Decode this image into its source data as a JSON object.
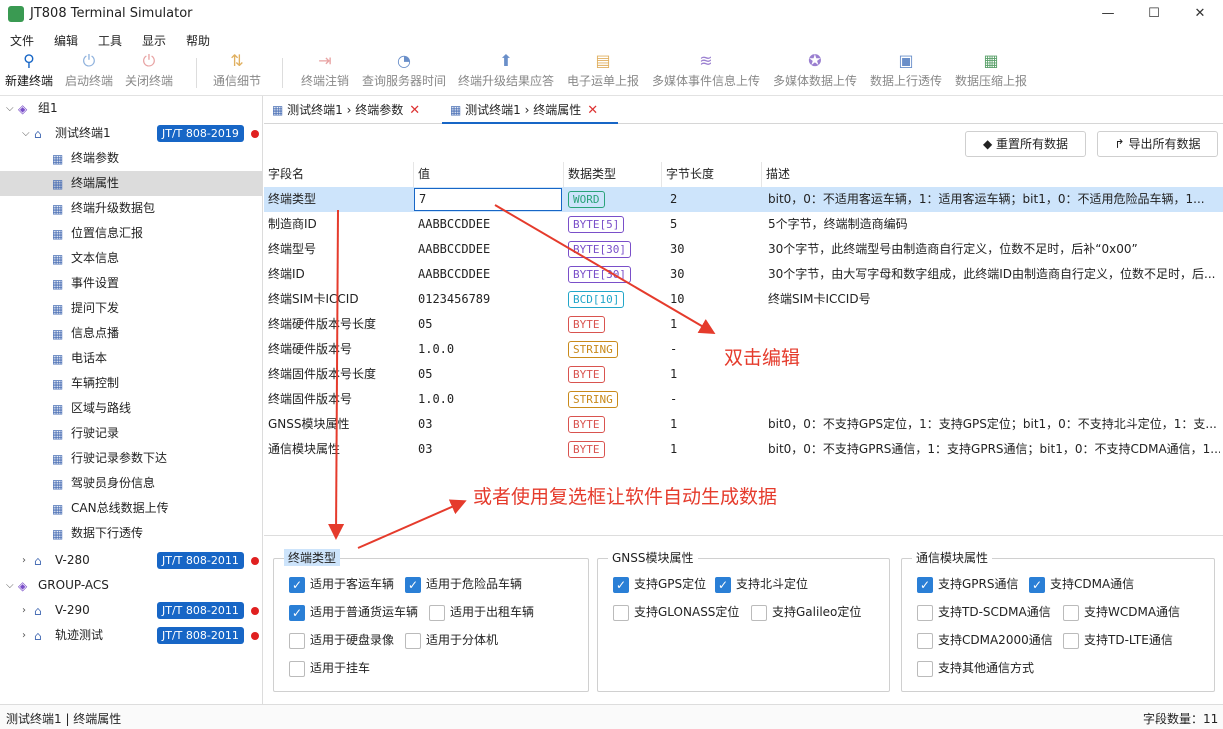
{
  "window": {
    "title": "JT808 Terminal Simulator",
    "min": "—",
    "max": "☐",
    "close": "✕"
  },
  "menu": [
    "文件",
    "编辑",
    "工具",
    "显示",
    "帮助"
  ],
  "toolbar": [
    {
      "label": "新建终端",
      "icon": "new-terminal-icon",
      "enabled": true
    },
    {
      "label": "启动终端",
      "icon": "power-icon",
      "enabled": false
    },
    {
      "label": "关闭终端",
      "icon": "power-off-icon",
      "enabled": false
    },
    {
      "label": "通信细节",
      "icon": "traffic-icon",
      "enabled": false
    },
    {
      "label": "终端注销",
      "icon": "logout-icon",
      "enabled": false
    },
    {
      "label": "查询服务器时间",
      "icon": "clock-icon",
      "enabled": false
    },
    {
      "label": "终端升级结果应答",
      "icon": "upload-icon",
      "enabled": false
    },
    {
      "label": "电子运单上报",
      "icon": "clipboard-icon",
      "enabled": false
    },
    {
      "label": "多媒体事件信息上传",
      "icon": "audio-wave-icon",
      "enabled": false
    },
    {
      "label": "多媒体数据上传",
      "icon": "film-reel-icon",
      "enabled": false
    },
    {
      "label": "数据上行透传",
      "icon": "data-up-icon",
      "enabled": false
    },
    {
      "label": "数据压缩上报",
      "icon": "package-icon",
      "enabled": false
    }
  ],
  "tree": {
    "group1": "组1",
    "terminal1": {
      "label": "测试终端1",
      "badge": "JT/T 808-2019"
    },
    "children": [
      "终端参数",
      "终端属性",
      "终端升级数据包",
      "位置信息汇报",
      "文本信息",
      "事件设置",
      "提问下发",
      "信息点播",
      "电话本",
      "车辆控制",
      "区域与路线",
      "行驶记录",
      "行驶记录参数下达",
      "驾驶员身份信息",
      "CAN总线数据上传",
      "数据下行透传"
    ],
    "selected_index": 1,
    "v280": {
      "label": "V-280",
      "badge": "JT/T 808-2011"
    },
    "group_acs": "GROUP-ACS",
    "v290": {
      "label": "V-290",
      "badge": "JT/T 808-2011"
    },
    "track": {
      "label": "轨迹测试",
      "badge": "JT/T 808-2011"
    }
  },
  "tabs": [
    {
      "label": "测试终端1 › 终端参数",
      "close": "✕"
    },
    {
      "label": "测试终端1 › 终端属性",
      "close": "✕"
    }
  ],
  "actions": {
    "reset": "重置所有数据",
    "export": "导出所有数据"
  },
  "grid": {
    "headers": [
      "字段名",
      "值",
      "数据类型",
      "字节长度",
      "描述"
    ],
    "rows": [
      {
        "name": "终端类型",
        "value": "7",
        "type": "WORD",
        "len": "2",
        "desc": "bit0，0：不适用客运车辆，1：适用客运车辆；bit1，0：不适用危险品车辆，1..."
      },
      {
        "name": "制造商ID",
        "value": "AABBCCDDEE",
        "type": "BYTE[5]",
        "len": "5",
        "desc": "5个字节，终端制造商编码"
      },
      {
        "name": "终端型号",
        "value": "AABBCCDDEE",
        "type": "BYTE[30]",
        "len": "30",
        "desc": "30个字节，此终端型号由制造商自行定义，位数不足时，后补“0x00”"
      },
      {
        "name": "终端ID",
        "value": "AABBCCDDEE",
        "type": "BYTE[30]",
        "len": "30",
        "desc": "30个字节，由大写字母和数字组成，此终端ID由制造商自行定义，位数不足时，后..."
      },
      {
        "name": "终端SIM卡ICCID",
        "value": "0123456789",
        "type": "BCD[10]",
        "len": "10",
        "desc": "终端SIM卡ICCID号"
      },
      {
        "name": "终端硬件版本号长度",
        "value": "05",
        "type": "BYTE",
        "len": "1",
        "desc": ""
      },
      {
        "name": "终端硬件版本号",
        "value": "1.0.0",
        "type": "STRING",
        "len": "-",
        "desc": ""
      },
      {
        "name": "终端固件版本号长度",
        "value": "05",
        "type": "BYTE",
        "len": "1",
        "desc": ""
      },
      {
        "name": "终端固件版本号",
        "value": "1.0.0",
        "type": "STRING",
        "len": "-",
        "desc": ""
      },
      {
        "name": "GNSS模块属性",
        "value": "03",
        "type": "BYTE",
        "len": "1",
        "desc": "bit0，0：不支持GPS定位，1：支持GPS定位；bit1，0：不支持北斗定位，1：支..."
      },
      {
        "name": "通信模块属性",
        "value": "03",
        "type": "BYTE",
        "len": "1",
        "desc": "bit0，0：不支持GPRS通信，1：支持GPRS通信；bit1，0：不支持CDMA通信，1..."
      }
    ]
  },
  "type_colors": {
    "WORD": "#2aa37a",
    "BYTE[5]": "#7a4fc9",
    "BYTE[30]": "#7a4fc9",
    "BCD[10]": "#22a6c9",
    "BYTE": "#d9534f",
    "STRING": "#c98a1a"
  },
  "groups": {
    "terminal_type": {
      "title": "终端类型",
      "items": [
        {
          "label": "适用于客运车辆",
          "checked": true
        },
        {
          "label": "适用于危险品车辆",
          "checked": true
        },
        {
          "label": "适用于普通货运车辆",
          "checked": true
        },
        {
          "label": "适用于出租车辆",
          "checked": false
        },
        {
          "label": "适用于硬盘录像",
          "checked": false
        },
        {
          "label": "适用于分体机",
          "checked": false
        },
        {
          "label": "适用于挂车",
          "checked": false
        }
      ]
    },
    "gnss": {
      "title": "GNSS模块属性",
      "items": [
        {
          "label": "支持GPS定位",
          "checked": true
        },
        {
          "label": "支持北斗定位",
          "checked": true
        },
        {
          "label": "支持GLONASS定位",
          "checked": false
        },
        {
          "label": "支持Galileo定位",
          "checked": false
        }
      ]
    },
    "comm": {
      "title": "通信模块属性",
      "items": [
        {
          "label": "支持GPRS通信",
          "checked": true
        },
        {
          "label": "支持CDMA通信",
          "checked": true
        },
        {
          "label": "支持TD-SCDMA通信",
          "checked": false
        },
        {
          "label": "支持WCDMA通信",
          "checked": false
        },
        {
          "label": "支持CDMA2000通信",
          "checked": false
        },
        {
          "label": "支持TD-LTE通信",
          "checked": false
        },
        {
          "label": "支持其他通信方式",
          "checked": false
        }
      ]
    }
  },
  "status": {
    "left": "测试终端1 | 终端属性",
    "right": "字段数量：11"
  },
  "annotations": {
    "dbl": "双击编辑",
    "auto": "或者使用复选框让软件自动生成数据"
  }
}
